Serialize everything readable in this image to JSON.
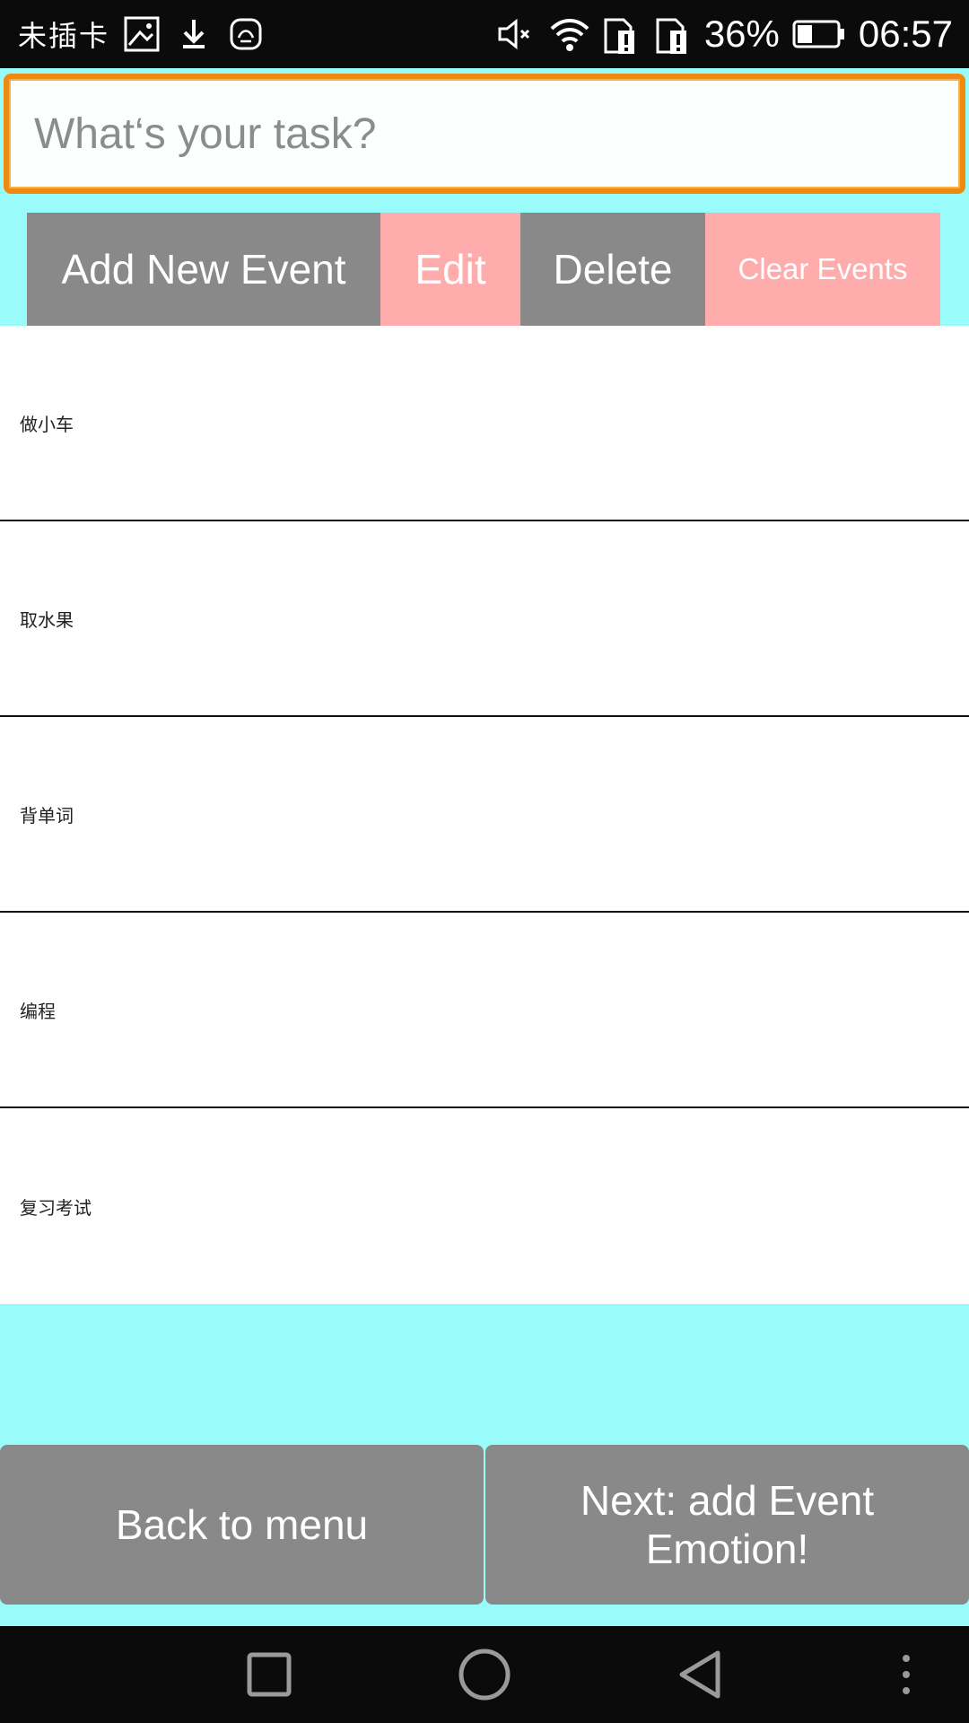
{
  "status_bar": {
    "carrier": "未插卡",
    "battery_percent": "36%",
    "time": "06:57",
    "icons": [
      "image-icon",
      "download-icon",
      "huawei-icon",
      "mute-icon",
      "wifi-icon",
      "sim-alert-icon",
      "sim-alert-icon-2",
      "battery-icon"
    ]
  },
  "task_input": {
    "placeholder": "What‘s your task?",
    "value": ""
  },
  "actions": {
    "add_label": "Add New Event",
    "edit_label": "Edit",
    "delete_label": "Delete",
    "clear_label": "Clear Events"
  },
  "events": [
    "做小车",
    "取水果",
    "背单词",
    "编程",
    "复习考试"
  ],
  "bottom": {
    "back_label": "Back to menu",
    "next_label": "Next: add Event Emotion!"
  },
  "nav": {
    "icons": [
      "recents-icon",
      "home-icon",
      "back-icon",
      "more-icon"
    ]
  },
  "colors": {
    "background": "#99fcfb",
    "gray_button": "#898989",
    "pink_button": "#ffacad",
    "input_border": "#ef8a11"
  }
}
